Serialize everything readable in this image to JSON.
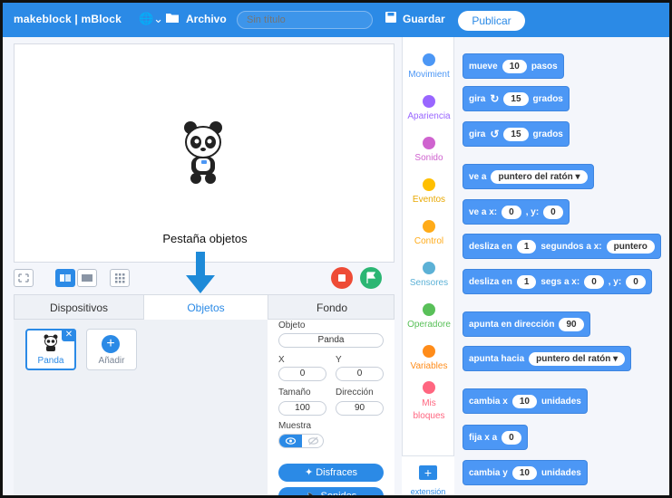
{
  "topbar": {
    "brand": "makeblock | mBlock",
    "globe_icon": "globe-icon",
    "archivo": "Archivo",
    "title_placeholder": "Sin título",
    "guardar": "Guardar",
    "publicar": "Publicar"
  },
  "stage": {
    "caption": "Pestaña objetos"
  },
  "tabs": {
    "dispositivos": "Dispositivos",
    "objetos": "Objetos",
    "fondo": "Fondo"
  },
  "sprites": {
    "panda_label": "Panda",
    "add_label": "Añadir"
  },
  "props": {
    "objeto_label": "Objeto",
    "objeto_value": "Panda",
    "x_label": "X",
    "y_label": "Y",
    "x_value": "0",
    "y_value": "0",
    "tamano_label": "Tamaño",
    "direccion_label": "Dirección",
    "tamano_value": "100",
    "direccion_value": "90",
    "muestra_label": "Muestra",
    "disfraces": "Disfraces",
    "sonidos": "Sonidos"
  },
  "categories": [
    {
      "label": "Movimient",
      "color": "#4c97f5"
    },
    {
      "label": "Apariencia",
      "color": "#9966ff"
    },
    {
      "label": "Sonido",
      "color": "#cf63cf"
    },
    {
      "label": "Eventos",
      "color": "#ffbf00"
    },
    {
      "label": "Control",
      "color": "#ffab19"
    },
    {
      "label": "Sensores",
      "color": "#5cb1d6"
    },
    {
      "label": "Operadore",
      "color": "#59c059"
    },
    {
      "label": "Variables",
      "color": "#ff8c1a"
    },
    {
      "label": "Mis bloques",
      "color": "#ff6680"
    }
  ],
  "extension_label": "extensión",
  "blocks": {
    "b1": {
      "t1": "mueve",
      "v1": "10",
      "t2": "pasos"
    },
    "b2": {
      "t1": "gira",
      "v1": "15",
      "t2": "grados"
    },
    "b3": {
      "t1": "gira",
      "v1": "15",
      "t2": "grados"
    },
    "b4": {
      "t1": "ve a",
      "drop": "puntero del ratón ▾"
    },
    "b5": {
      "t1": "ve a x:",
      "v1": "0",
      "t2": ", y:",
      "v2": "0"
    },
    "b6": {
      "t1": "desliza en",
      "v1": "1",
      "t2": "segundos a x:",
      "drop": "puntero"
    },
    "b7": {
      "t1": "desliza en",
      "v1": "1",
      "t2": "segs a x:",
      "v2": "0",
      "t3": ", y:",
      "v3": "0"
    },
    "b8": {
      "t1": "apunta en dirección",
      "v1": "90"
    },
    "b9": {
      "t1": "apunta hacia",
      "drop": "puntero del ratón ▾"
    },
    "b10": {
      "t1": "cambia x",
      "v1": "10",
      "t2": "unidades"
    },
    "b11": {
      "t1": "fija x a",
      "v1": "0"
    },
    "b12": {
      "t1": "cambia y",
      "v1": "10",
      "t2": "unidades"
    }
  }
}
